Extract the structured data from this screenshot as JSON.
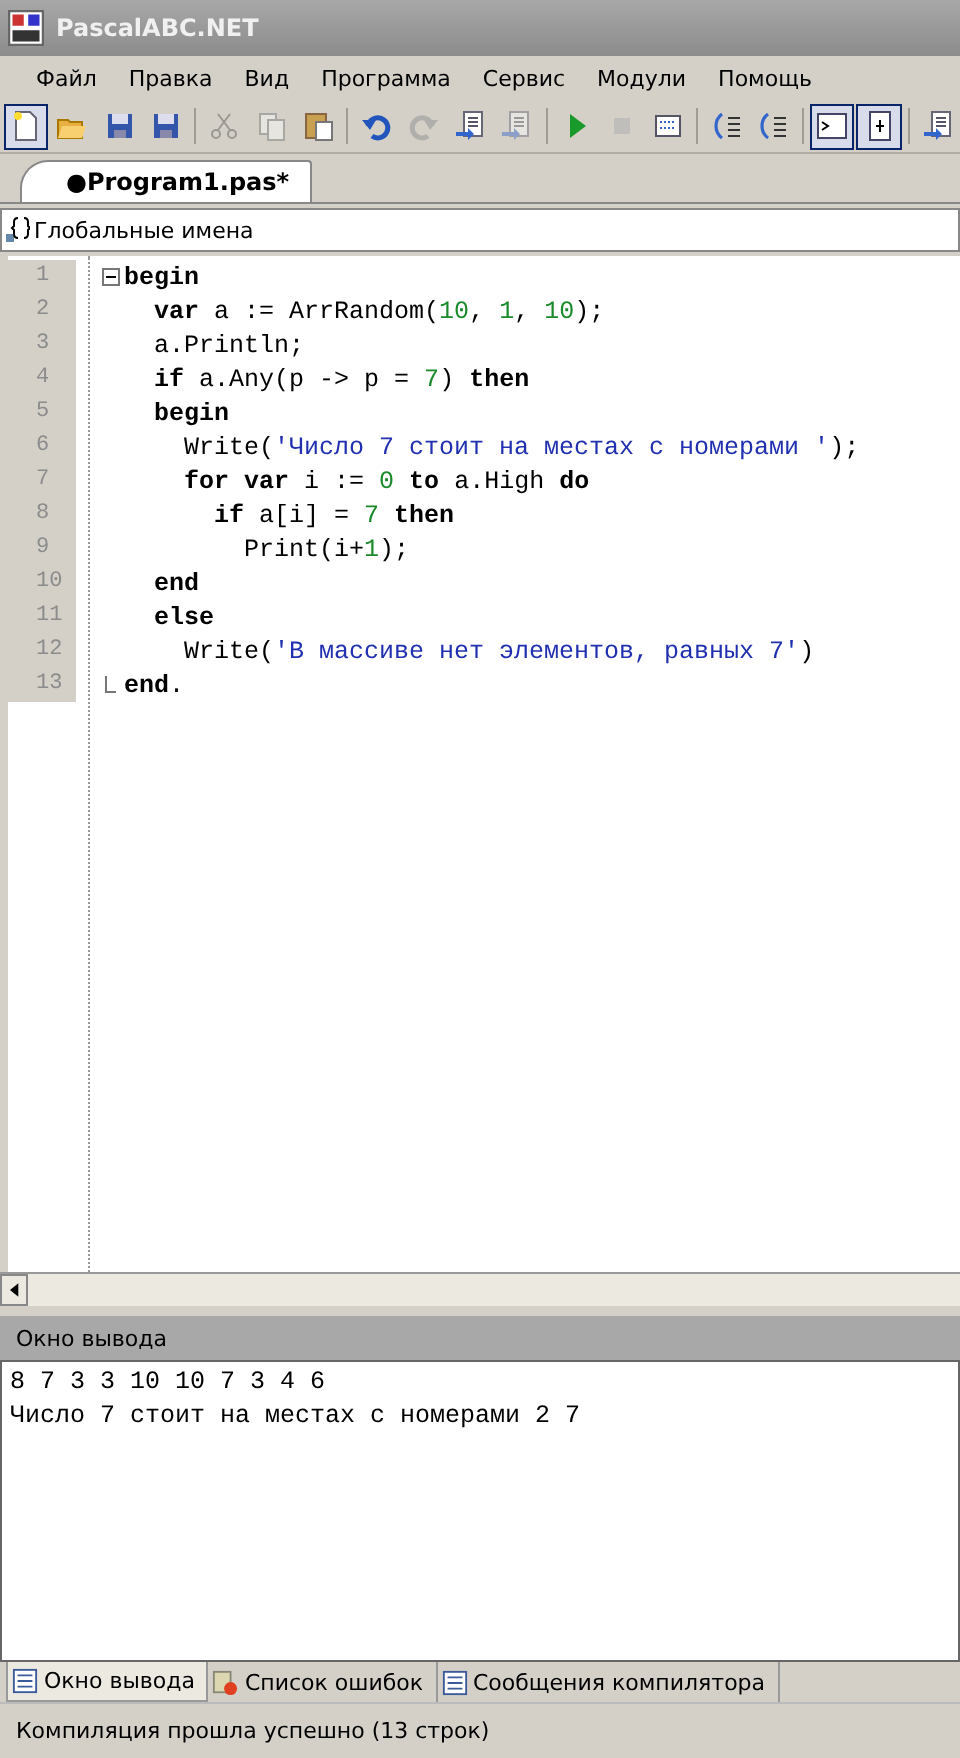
{
  "window": {
    "title": "PascalABC.NET"
  },
  "menu": [
    "Файл",
    "Правка",
    "Вид",
    "Программа",
    "Сервис",
    "Модули",
    "Помощь"
  ],
  "toolbar": [
    {
      "kind": "new",
      "pressed": true,
      "disabled": false
    },
    {
      "kind": "open",
      "pressed": false,
      "disabled": false
    },
    {
      "kind": "save",
      "pressed": false,
      "disabled": false
    },
    {
      "kind": "save-all",
      "pressed": false,
      "disabled": false
    },
    {
      "kind": "sep"
    },
    {
      "kind": "cut",
      "pressed": false,
      "disabled": true
    },
    {
      "kind": "copy",
      "pressed": false,
      "disabled": true
    },
    {
      "kind": "paste",
      "pressed": false,
      "disabled": false
    },
    {
      "kind": "sep"
    },
    {
      "kind": "undo",
      "pressed": false,
      "disabled": false
    },
    {
      "kind": "redo",
      "pressed": false,
      "disabled": true
    },
    {
      "kind": "doc-in",
      "pressed": false,
      "disabled": false
    },
    {
      "kind": "doc-out",
      "pressed": false,
      "disabled": true
    },
    {
      "kind": "sep"
    },
    {
      "kind": "run",
      "pressed": false,
      "disabled": false
    },
    {
      "kind": "stop",
      "pressed": false,
      "disabled": true
    },
    {
      "kind": "compile",
      "pressed": false,
      "disabled": false
    },
    {
      "kind": "sep"
    },
    {
      "kind": "step-into",
      "pressed": false,
      "disabled": false
    },
    {
      "kind": "step-over",
      "pressed": false,
      "disabled": false
    },
    {
      "kind": "sep"
    },
    {
      "kind": "console",
      "pressed": true,
      "disabled": false
    },
    {
      "kind": "output",
      "pressed": true,
      "disabled": false
    },
    {
      "kind": "sep"
    },
    {
      "kind": "doc",
      "pressed": false,
      "disabled": false
    }
  ],
  "tabs": [
    {
      "label": "●Program1.pas*",
      "selected": true
    }
  ],
  "scope": {
    "label": "Глобальные имена"
  },
  "code": [
    {
      "number": "1",
      "fold_start": true,
      "tokens": [
        {
          "kind": "kw",
          "text": "begin"
        }
      ]
    },
    {
      "number": "2",
      "tokens": [
        {
          "kind": "kw",
          "text": "  var"
        },
        {
          "kind": "plain",
          "text": " a := ArrRandom("
        },
        {
          "kind": "num",
          "text": "10"
        },
        {
          "kind": "plain",
          "text": ", "
        },
        {
          "kind": "num",
          "text": "1"
        },
        {
          "kind": "plain",
          "text": ", "
        },
        {
          "kind": "num",
          "text": "10"
        },
        {
          "kind": "plain",
          "text": ");"
        }
      ]
    },
    {
      "number": "3",
      "tokens": [
        {
          "kind": "plain",
          "text": "  a.Println;"
        }
      ]
    },
    {
      "number": "4",
      "tokens": [
        {
          "kind": "kw",
          "text": "  if"
        },
        {
          "kind": "plain",
          "text": " a.Any(p -> p = "
        },
        {
          "kind": "num",
          "text": "7"
        },
        {
          "kind": "plain",
          "text": ") "
        },
        {
          "kind": "kw",
          "text": "then"
        }
      ]
    },
    {
      "number": "5",
      "tokens": [
        {
          "kind": "kw",
          "text": "  begin"
        }
      ]
    },
    {
      "number": "6",
      "tokens": [
        {
          "kind": "plain",
          "text": "    Write("
        },
        {
          "kind": "str",
          "text": "'Число 7 стоит на местах с номерами '"
        },
        {
          "kind": "plain",
          "text": ");"
        }
      ]
    },
    {
      "number": "7",
      "tokens": [
        {
          "kind": "kw",
          "text": "    for var"
        },
        {
          "kind": "plain",
          "text": " i := "
        },
        {
          "kind": "num",
          "text": "0"
        },
        {
          "kind": "kw",
          "text": " to"
        },
        {
          "kind": "plain",
          "text": " a.High "
        },
        {
          "kind": "kw",
          "text": "do"
        }
      ]
    },
    {
      "number": "8",
      "tokens": [
        {
          "kind": "kw",
          "text": "      if"
        },
        {
          "kind": "plain",
          "text": " a[i] = "
        },
        {
          "kind": "num",
          "text": "7"
        },
        {
          "kind": "kw",
          "text": " then"
        }
      ]
    },
    {
      "number": "9",
      "tokens": [
        {
          "kind": "plain",
          "text": "        Print(i+"
        },
        {
          "kind": "num",
          "text": "1"
        },
        {
          "kind": "plain",
          "text": ");"
        }
      ]
    },
    {
      "number": "10",
      "tokens": [
        {
          "kind": "kw",
          "text": "  end"
        }
      ]
    },
    {
      "number": "11",
      "tokens": [
        {
          "kind": "kw",
          "text": "  else"
        }
      ]
    },
    {
      "number": "12",
      "tokens": [
        {
          "kind": "plain",
          "text": "    Write("
        },
        {
          "kind": "str",
          "text": "'В массиве нет элементов, равных 7'"
        },
        {
          "kind": "plain",
          "text": ")"
        }
      ]
    },
    {
      "number": "13",
      "fold_end": true,
      "tokens": [
        {
          "kind": "kw",
          "text": "end"
        },
        {
          "kind": "plain",
          "text": "."
        }
      ]
    }
  ],
  "output": {
    "title": "Окно вывода",
    "lines": [
      "8 7 3 3 10 10 7 3 4 6",
      "Число 7 стоит на местах с номерами 2 7"
    ]
  },
  "bottom_tabs": [
    {
      "kind": "output",
      "label": "Окно вывода",
      "selected": true
    },
    {
      "kind": "errors",
      "label": "Список ошибок",
      "selected": false
    },
    {
      "kind": "messages",
      "label": "Сообщения компилятора",
      "selected": false
    }
  ],
  "status_bar": "Компиляция прошла успешно (13 строк)"
}
